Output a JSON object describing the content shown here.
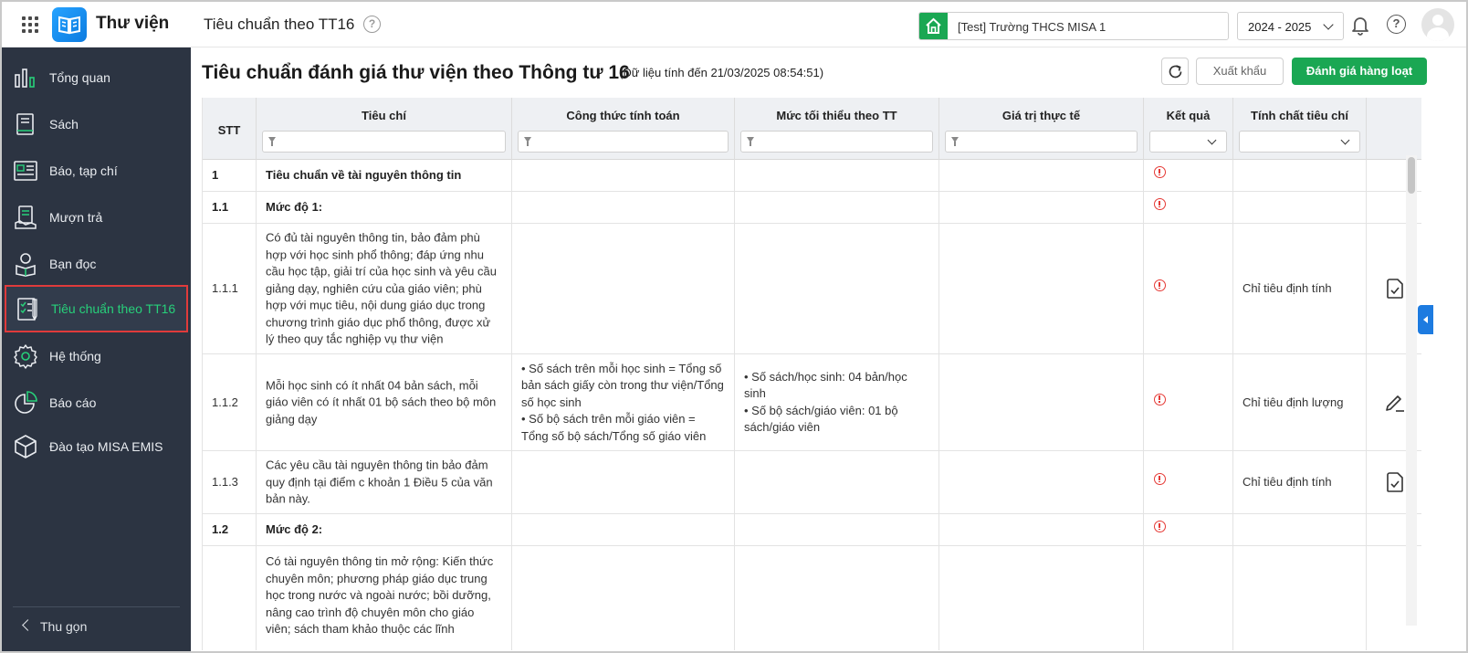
{
  "topbar": {
    "brand": "Thư viện",
    "page_title": "Tiêu chuẩn theo TT16",
    "school": "[Test] Trường THCS MISA 1",
    "year": "2024 - 2025"
  },
  "sidebar": {
    "items": [
      {
        "label": "Tổng quan",
        "icon": "chart-bars-icon"
      },
      {
        "label": "Sách",
        "icon": "book-icon"
      },
      {
        "label": "Báo, tạp chí",
        "icon": "newspaper-icon"
      },
      {
        "label": "Mượn trả",
        "icon": "borrow-icon"
      },
      {
        "label": "Bạn đọc",
        "icon": "reader-icon"
      },
      {
        "label": "Tiêu chuẩn theo TT16",
        "icon": "checklist-icon"
      },
      {
        "label": "Hệ thống",
        "icon": "gear-icon"
      },
      {
        "label": "Báo cáo",
        "icon": "pie-chart-icon"
      },
      {
        "label": "Đào tạo MISA EMIS",
        "icon": "box-icon"
      }
    ],
    "collapse_label": "Thu gọn"
  },
  "main": {
    "title": "Tiêu chuẩn đánh giá thư viện theo Thông tư 16",
    "subtitle": "(Dữ liệu tính đến 21/03/2025 08:54:51)",
    "export_label": "Xuất khẩu",
    "bulk_label": "Đánh giá hàng loạt"
  },
  "table": {
    "columns": [
      "STT",
      "Tiêu chí",
      "Công thức tính toán",
      "Mức tối thiểu theo TT",
      "Giá trị thực tế",
      "Kết quả",
      "Tính chất tiêu chí"
    ],
    "rows": [
      {
        "stt": "1",
        "criteria": "Tiêu chuẩn về tài nguyên thông tin",
        "formula": [],
        "minimum": [],
        "actual": "",
        "result": "not-met",
        "nature": "",
        "action": "",
        "bold": true
      },
      {
        "stt": "1.1",
        "criteria": "Mức độ 1:",
        "formula": [],
        "minimum": [],
        "actual": "",
        "result": "not-met",
        "nature": "",
        "action": "",
        "bold": true
      },
      {
        "stt": "1.1.1",
        "criteria": "Có đủ tài nguyên thông tin, bảo đảm phù hợp với học sinh phổ thông; đáp ứng nhu cầu học tập, giải trí của học sinh và yêu cầu giảng dạy, nghiên cứu của giáo viên; phù hợp với mục tiêu, nội dung giáo dục trong chương trình giáo dục phổ thông, được xử lý theo quy tắc nghiệp vụ thư viện",
        "formula": [],
        "minimum": [],
        "actual": "",
        "result": "not-met",
        "nature": "Chỉ tiêu định tính",
        "action": "check-doc-icon",
        "bold": false
      },
      {
        "stt": "1.1.2",
        "criteria": "Mỗi học sinh có ít nhất 04 bản sách, mỗi giáo viên có ít nhất 01 bộ sách theo bộ môn giảng dạy",
        "formula": [
          "• Số sách trên mỗi học sinh = Tổng số bản sách giấy còn trong thư viện/Tổng số học sinh",
          "• Số bộ sách trên mỗi giáo viên = Tổng số bộ sách/Tổng số giáo viên"
        ],
        "minimum": [
          "• Số sách/học sinh: 04 bản/học sinh",
          "• Số bộ sách/giáo viên: 01 bộ sách/giáo viên"
        ],
        "actual": "",
        "result": "not-met",
        "nature": "Chỉ tiêu định lượng",
        "action": "edit-icon",
        "bold": false
      },
      {
        "stt": "1.1.3",
        "criteria": "Các yêu cầu tài nguyên thông tin bảo đảm quy định tại điểm c khoản 1 Điều 5 của văn bản này.",
        "formula": [],
        "minimum": [],
        "actual": "",
        "result": "not-met",
        "nature": "Chỉ tiêu định tính",
        "action": "check-doc-icon",
        "bold": false
      },
      {
        "stt": "1.2",
        "criteria": "Mức độ 2:",
        "formula": [],
        "minimum": [],
        "actual": "",
        "result": "not-met",
        "nature": "",
        "action": "",
        "bold": true
      },
      {
        "stt": "",
        "criteria": "Có tài nguyên thông tin mở rộng: Kiến thức chuyên môn; phương pháp giáo dục trung học trong nước và ngoài nước; bồi dưỡng, nâng cao trình độ chuyên môn cho giáo viên; sách tham khảo thuộc các lĩnh",
        "formula": [],
        "minimum": [],
        "actual": "",
        "result": "",
        "nature": "",
        "action": "",
        "bold": false
      }
    ]
  },
  "colors": {
    "accent": "#1aa753",
    "sidebar_bg": "#2c3442",
    "active_text": "#27d07a",
    "danger": "#e53935"
  }
}
